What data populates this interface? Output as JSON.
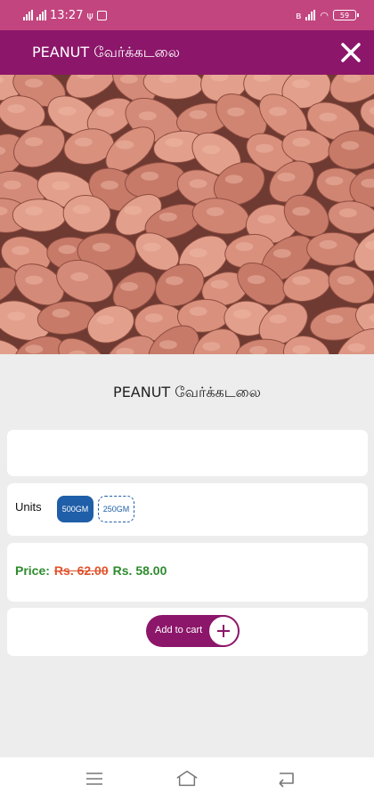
{
  "status_bar": {
    "time": "13:27",
    "battery_level": "59",
    "left_icons": [
      "signal-icon",
      "signal-icon",
      "usb-icon",
      "gallery-icon"
    ],
    "right_icons": [
      "bluetooth-icon",
      "signal-icon",
      "wifi-icon",
      "battery-icon"
    ]
  },
  "app_bar": {
    "title": "PEANUT வேர்க்கடலை",
    "close_icon": "close-icon",
    "color": "#8c166a"
  },
  "product": {
    "image_subject": "peanuts",
    "name": "PEANUT வேர்க்கடலை",
    "description": ""
  },
  "units": {
    "label": "Units",
    "options": [
      "500GM",
      "250GM"
    ],
    "selected": "500GM",
    "active_color": "#1f5ea8"
  },
  "price": {
    "label": "Price:",
    "original": "Rs. 62.00",
    "current": "Rs. 58.00",
    "label_color": "#2e8b2e",
    "strike_color": "#e0522b"
  },
  "cart": {
    "button_label": "Add to cart",
    "plus_icon": "plus-icon"
  },
  "nav_bar": {
    "icons": [
      "menu-icon",
      "home-icon",
      "back-icon"
    ]
  }
}
